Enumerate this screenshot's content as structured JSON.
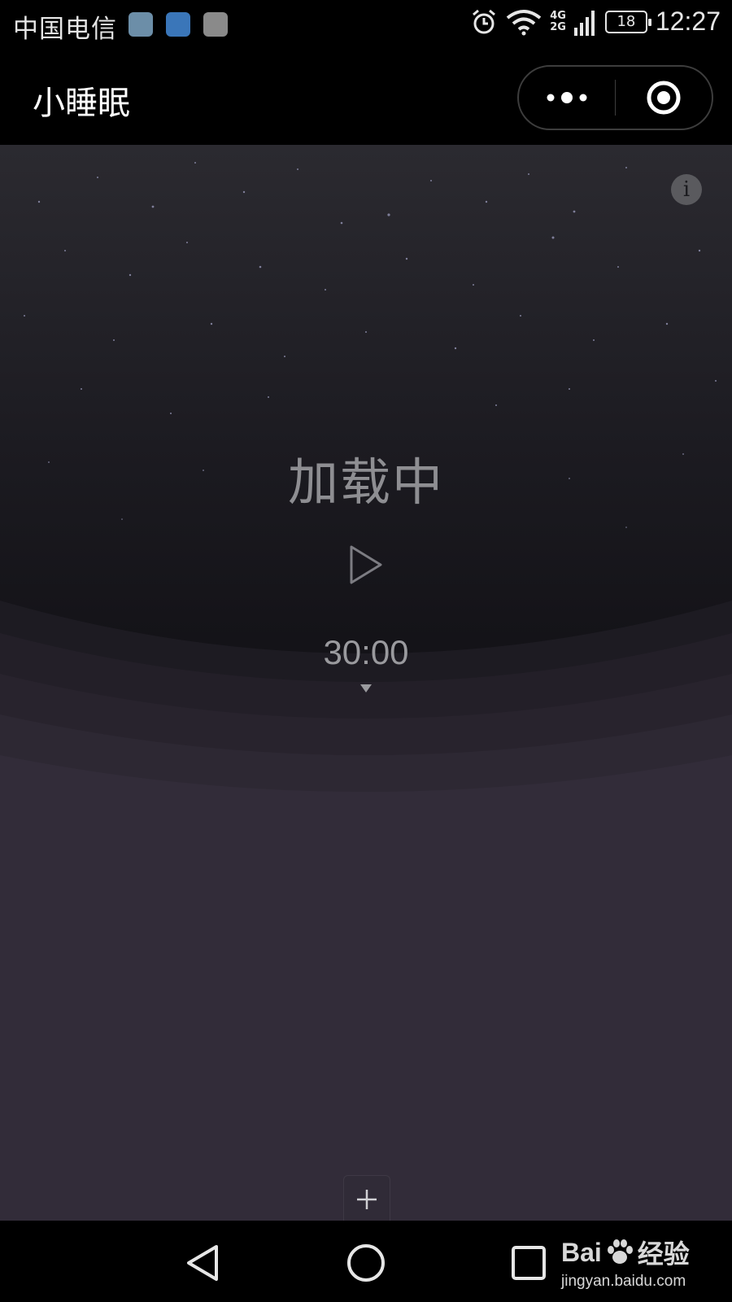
{
  "status_bar": {
    "carrier": "中国电信",
    "notification_icons": [
      "weather-icon",
      "health-icon",
      "gallery-icon"
    ],
    "network_top": "4G",
    "network_bottom": "2G",
    "battery_level": "18",
    "time": "12:27"
  },
  "title_bar": {
    "title": "小睡眠",
    "menu_icon": "more-dots-icon",
    "close_icon": "target-close-icon"
  },
  "main": {
    "loading_text": "加载中",
    "timer": "30:00",
    "play_icon": "play-icon",
    "info_icon": "info-icon",
    "add_icon": "plus-icon"
  },
  "nav_bar": {
    "back_icon": "back-triangle-icon",
    "home_icon": "home-circle-icon",
    "recent_icon": "recent-square-icon"
  },
  "watermark": {
    "brand_left": "Bai",
    "brand_right": "经验",
    "url": "jingyan.baidu.com"
  },
  "colors": {
    "background_top": "#2b2a30",
    "background_bottom": "#322c39",
    "text_muted": "#8e8e92"
  }
}
